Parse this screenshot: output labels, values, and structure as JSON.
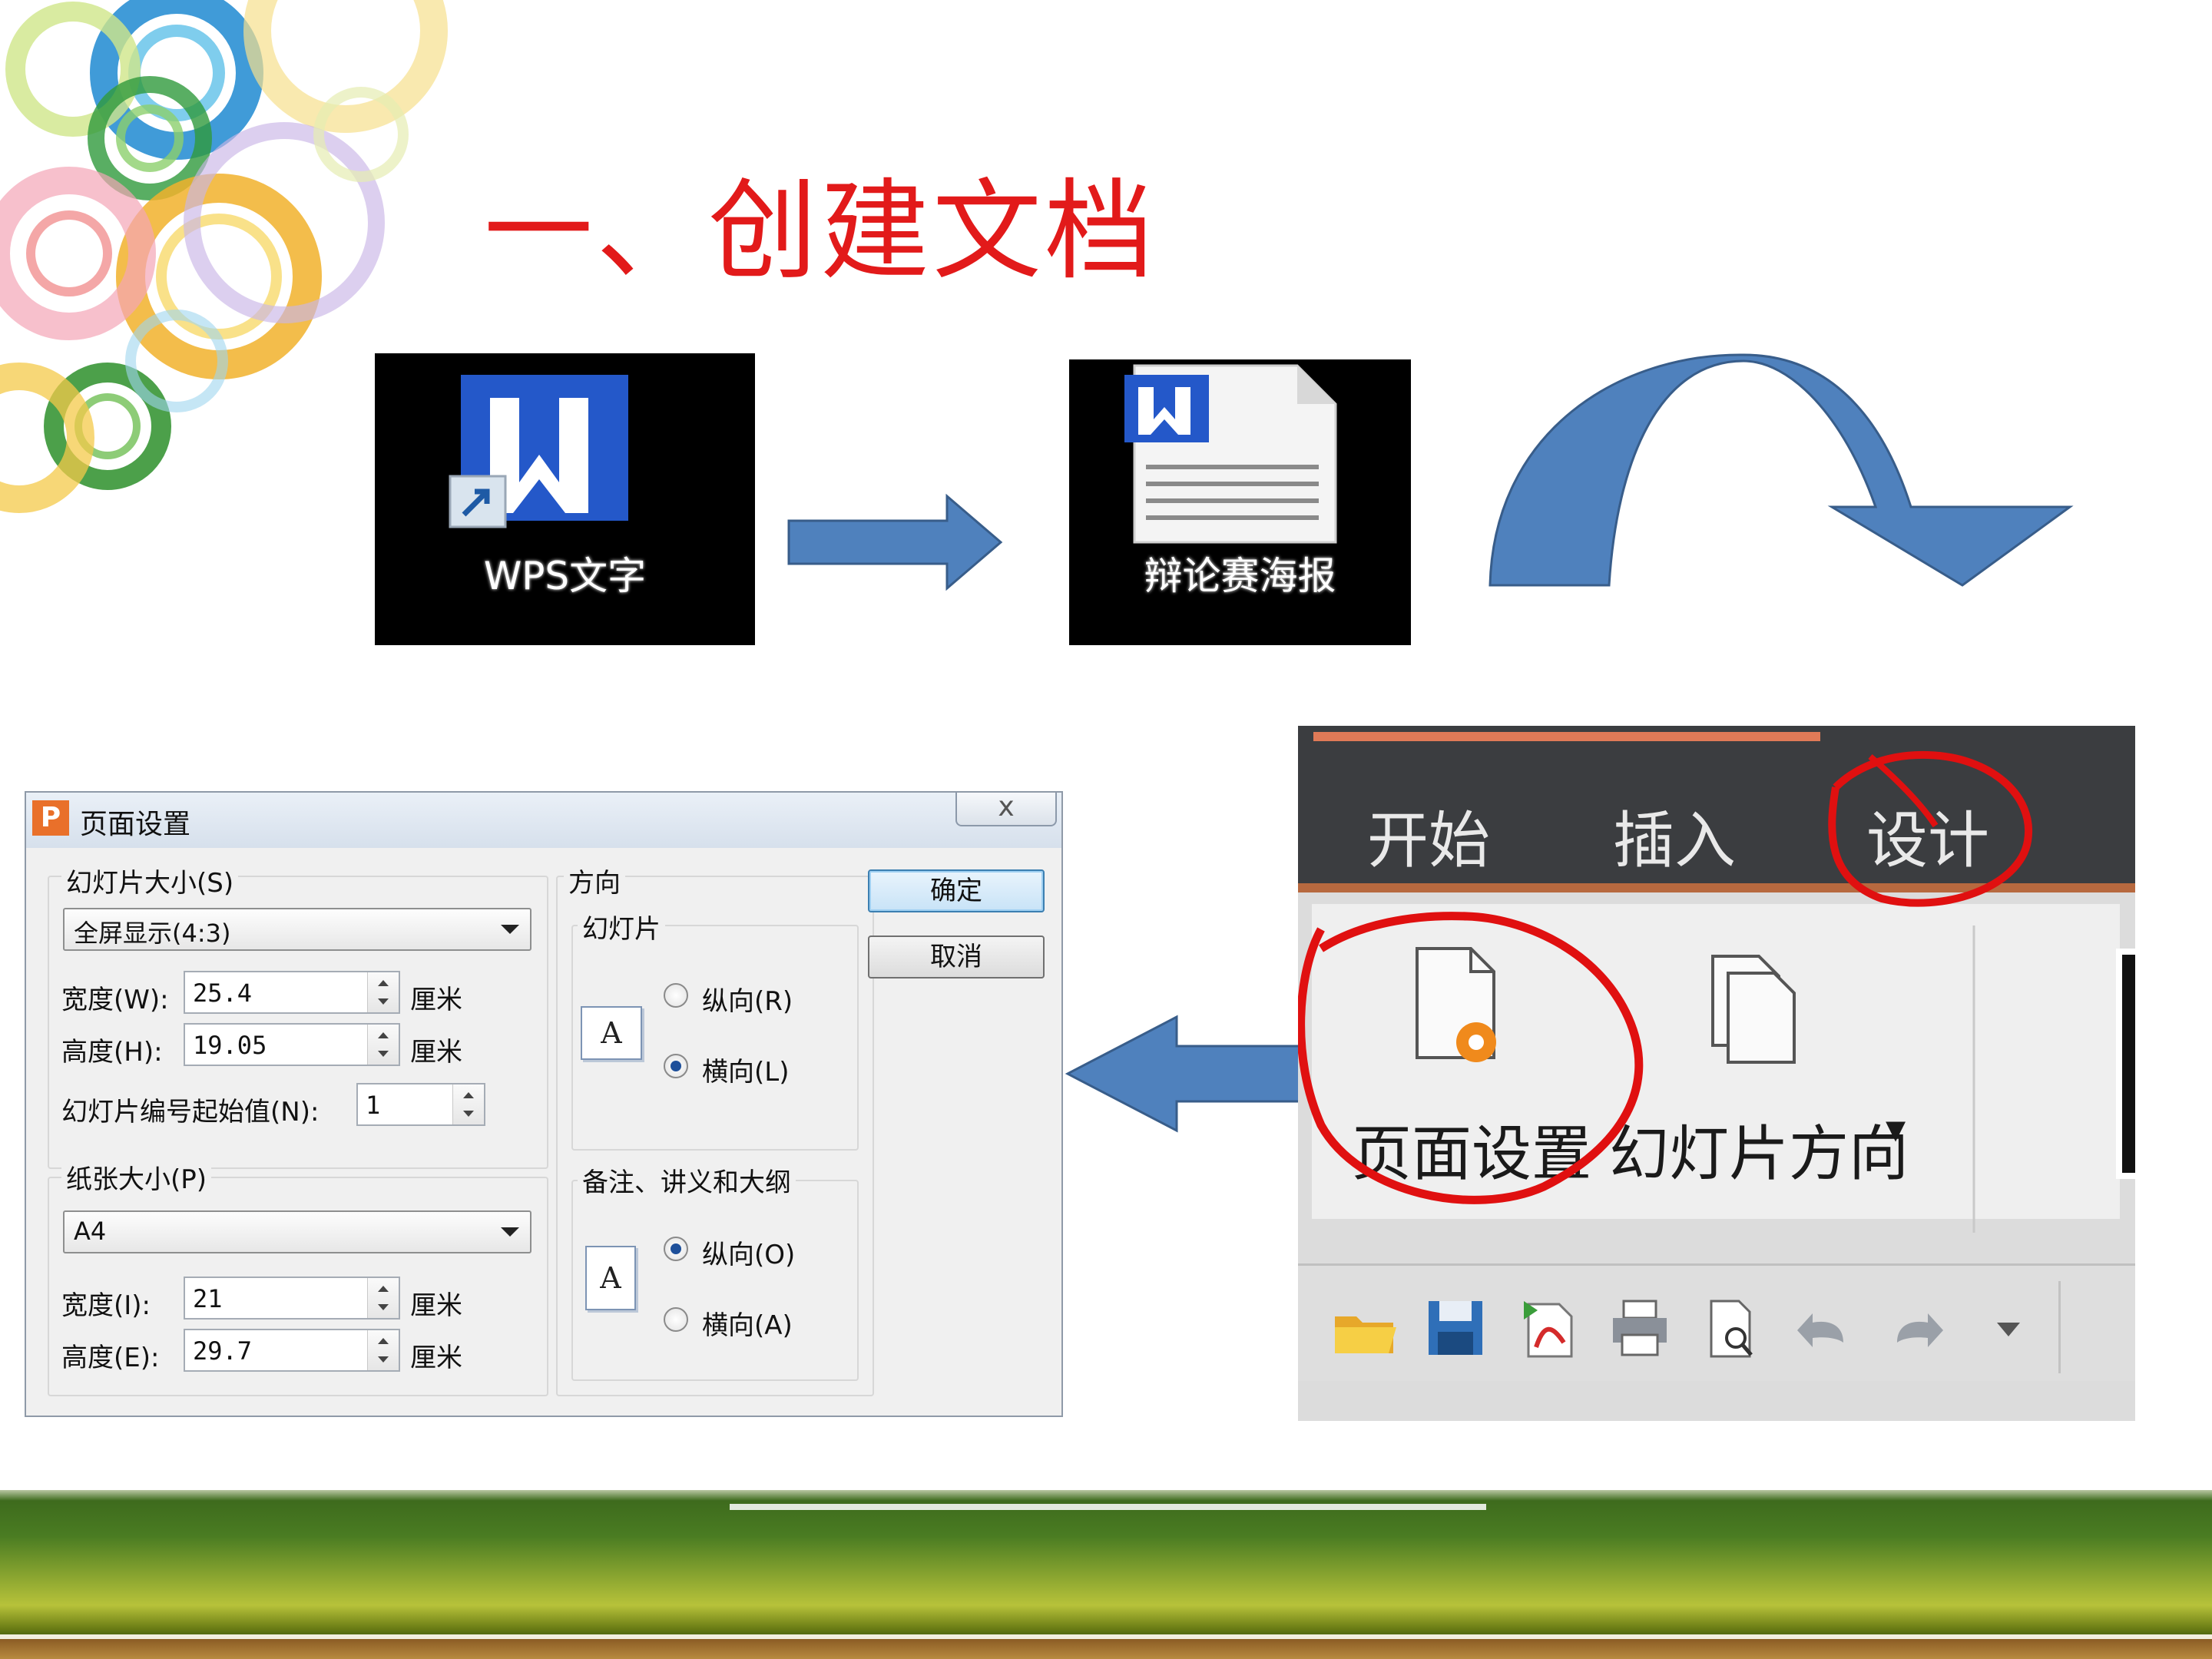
{
  "slide": {
    "title": "一、创建文档"
  },
  "desktop_icons": [
    {
      "label": "WPS文字",
      "icon": "wps-writer-shortcut-icon"
    },
    {
      "label": "辩论赛海报",
      "icon": "wps-document-file-icon"
    }
  ],
  "dialog": {
    "title": "页面设置",
    "close": "x",
    "slide_size_group": "幻灯片大小(S)",
    "slide_size_value": "全屏显示(4:3)",
    "width_label": "宽度(W):",
    "width_value": "25.4",
    "height_label": "高度(H):",
    "height_value": "19.05",
    "unit": "厘米",
    "start_number_label": "幻灯片编号起始值(N):",
    "start_number_value": "1",
    "paper_size_group": "纸张大小(P)",
    "paper_size_value": "A4",
    "paper_width_label": "宽度(I):",
    "paper_width_value": "21",
    "paper_height_label": "高度(E):",
    "paper_height_value": "29.7",
    "orientation_group": "方向",
    "slides_subgroup": "幻灯片",
    "slides_portrait": "纵向(R)",
    "slides_landscape": "横向(L)",
    "slides_selected": "landscape",
    "notes_subgroup": "备注、讲义和大纲",
    "notes_portrait": "纵向(O)",
    "notes_landscape": "横向(A)",
    "notes_selected": "portrait",
    "page_icon_letter": "A",
    "ok": "确定",
    "cancel": "取消"
  },
  "ribbon": {
    "tabs": [
      "开始",
      "插入",
      "设计"
    ],
    "highlighted_tab": "设计",
    "page_setup_label": "页面设置",
    "slide_orientation_label": "幻灯片方向",
    "dropdown_glyph": "▾",
    "quick_access_icons": [
      "open-folder-icon",
      "save-icon",
      "export-pdf-icon",
      "print-icon",
      "print-preview-icon",
      "undo-icon",
      "redo-icon",
      "customize-dropdown-icon"
    ]
  },
  "colors": {
    "title_red": "#e21a1a",
    "arrow_blue": "#4f81bd",
    "arrow_stroke": "#385d8a",
    "highlight_circle": "#e01010"
  }
}
